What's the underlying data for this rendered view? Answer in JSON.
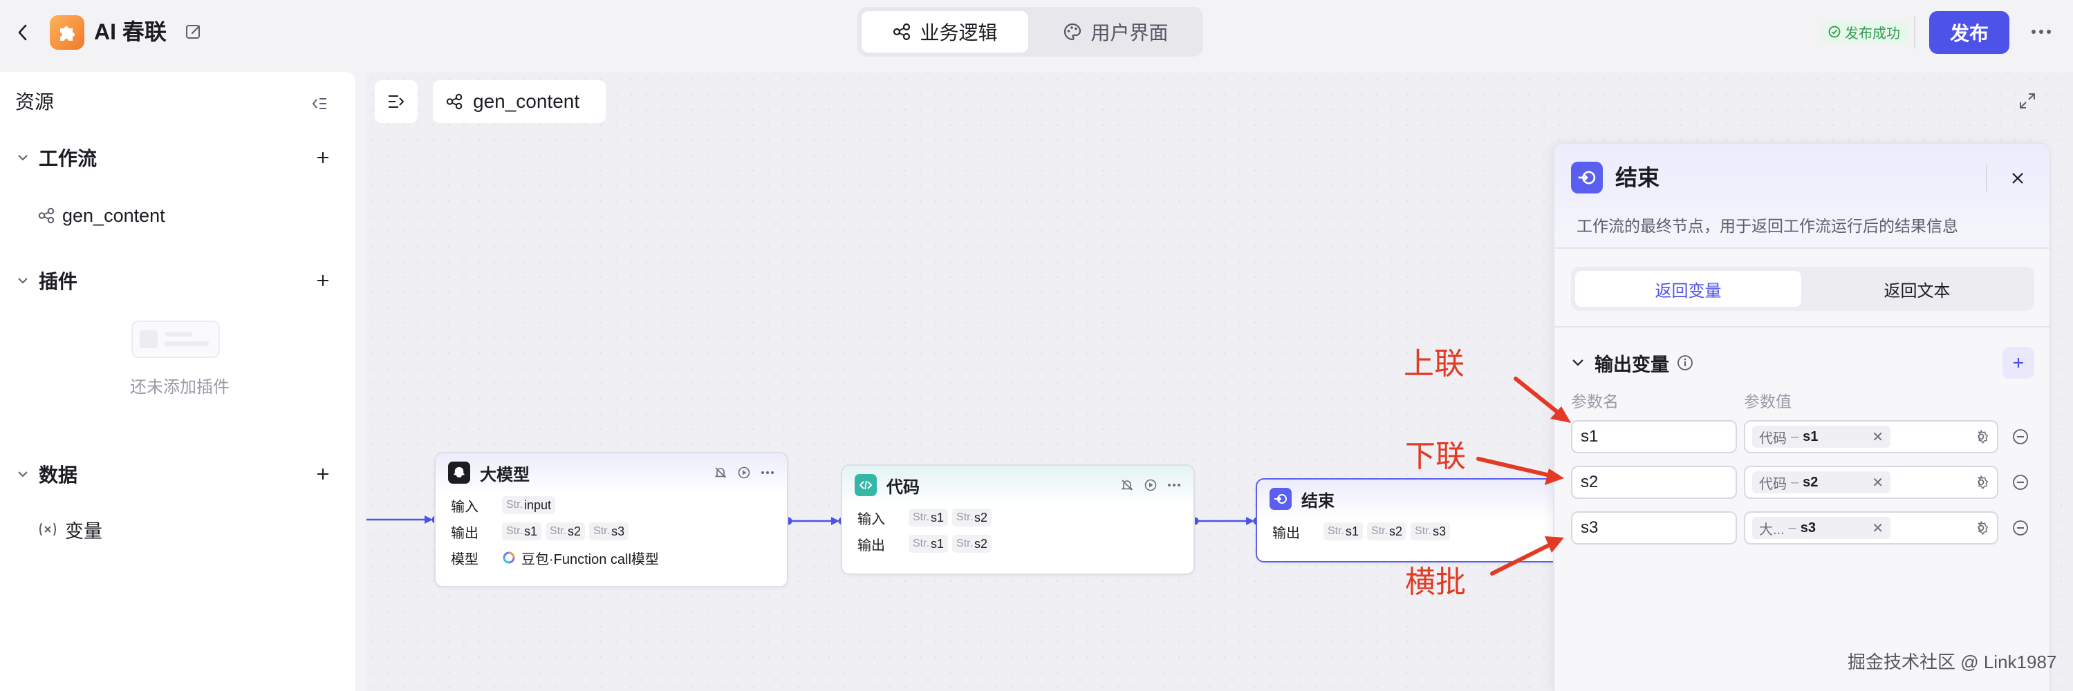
{
  "app": {
    "title": "AI 春联"
  },
  "top_tabs": [
    {
      "label": "业务逻辑",
      "active": true
    },
    {
      "label": "用户界面",
      "active": false
    }
  ],
  "publish": {
    "status": "发布成功",
    "button": "发布"
  },
  "sidebar": {
    "title": "资源",
    "sections": {
      "workflow": {
        "label": "工作流",
        "items": [
          "gen_content"
        ]
      },
      "plugin": {
        "label": "插件",
        "empty_text": "还未添加插件"
      },
      "data": {
        "label": "数据",
        "items": [
          "变量"
        ]
      }
    }
  },
  "canvas": {
    "tab_label": "gen_content",
    "nodes": {
      "llm": {
        "title": "大模型",
        "input_label": "输入",
        "output_label": "输出",
        "model_label": "模型",
        "inputs": [
          {
            "type": "Str.",
            "name": "input"
          }
        ],
        "outputs": [
          {
            "type": "Str.",
            "name": "s1"
          },
          {
            "type": "Str.",
            "name": "s2"
          },
          {
            "type": "Str.",
            "name": "s3"
          }
        ],
        "model_value": "豆包·Function call模型"
      },
      "code": {
        "title": "代码",
        "input_label": "输入",
        "output_label": "输出",
        "inputs": [
          {
            "type": "Str.",
            "name": "s1"
          },
          {
            "type": "Str.",
            "name": "s2"
          }
        ],
        "outputs": [
          {
            "type": "Str.",
            "name": "s1"
          },
          {
            "type": "Str.",
            "name": "s2"
          }
        ]
      },
      "end": {
        "title": "结束",
        "output_label": "输出",
        "outputs": [
          {
            "type": "Str.",
            "name": "s1"
          },
          {
            "type": "Str.",
            "name": "s2"
          },
          {
            "type": "Str.",
            "name": "s3"
          }
        ]
      }
    }
  },
  "panel": {
    "title": "结束",
    "description": "工作流的最终节点，用于返回工作流运行后的结果信息",
    "tabs": [
      {
        "label": "返回变量",
        "active": true
      },
      {
        "label": "返回文本",
        "active": false
      }
    ],
    "output_section": "输出变量",
    "col_name": "参数名",
    "col_value": "参数值",
    "variables": [
      {
        "name": "s1",
        "source": "代码",
        "sep": "–",
        "value": "s1"
      },
      {
        "name": "s2",
        "source": "代码",
        "sep": "–",
        "value": "s2"
      },
      {
        "name": "s3",
        "source": "大...",
        "sep": "–",
        "value": "s3"
      }
    ]
  },
  "annotations": {
    "a1": "上联",
    "a2": "下联",
    "a3": "横批",
    "color": "#e23a25"
  },
  "watermark": "掘金技术社区 @ Link1987",
  "colors": {
    "accent": "#4d53e8",
    "success": "#2f9a4d"
  }
}
